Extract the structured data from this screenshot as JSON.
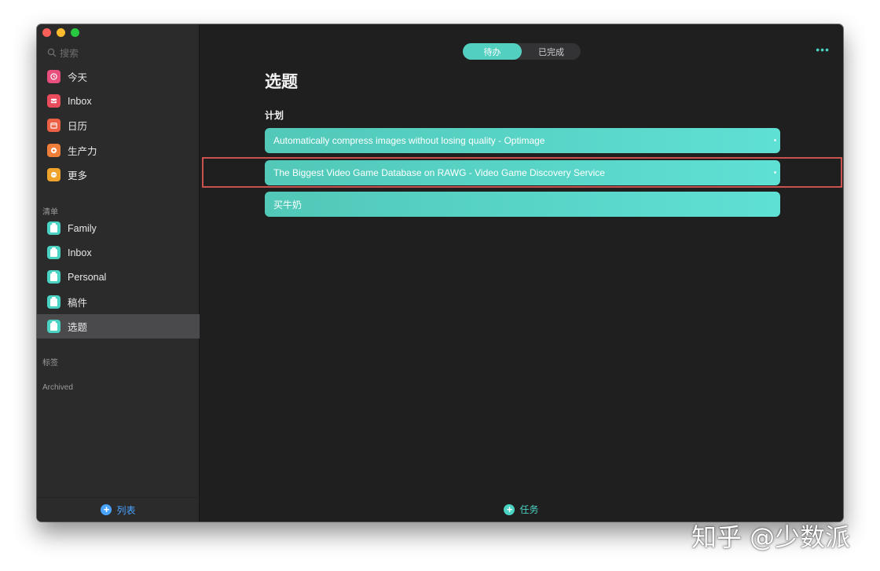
{
  "sidebar": {
    "search_placeholder": "搜索",
    "smart_lists": [
      {
        "label": "今天",
        "icon": "today-icon",
        "color": "#e94f7c"
      },
      {
        "label": "Inbox",
        "icon": "inbox-icon",
        "color": "#e84c5d"
      },
      {
        "label": "日历",
        "icon": "calendar-icon",
        "color": "#ec6045"
      },
      {
        "label": "生产力",
        "icon": "productivity-icon",
        "color": "#ef7e3a"
      },
      {
        "label": "更多",
        "icon": "more-icon",
        "color": "#f0a32b"
      }
    ],
    "lists_section_label": "清单",
    "lists": [
      {
        "label": "Family"
      },
      {
        "label": "Inbox"
      },
      {
        "label": "Personal"
      },
      {
        "label": "稿件"
      },
      {
        "label": "选题",
        "active": true
      }
    ],
    "tags_section_label": "标签",
    "archived_section_label": "Archived",
    "footer_label": "列表",
    "list_icon_color": "#4ad3c2",
    "footer_color": "#4aa3ff"
  },
  "main": {
    "tabs": [
      {
        "label": "待办",
        "active": true
      },
      {
        "label": "已完成",
        "active": false
      }
    ],
    "more_label": "•••",
    "title": "选题",
    "group_title": "计划",
    "tasks": [
      {
        "text": "Automatically compress images without losing quality - Optimage"
      },
      {
        "text": "The Biggest Video Game Database on RAWG - Video Game Discovery Service"
      },
      {
        "text": "买牛奶"
      }
    ],
    "footer_label": "任务",
    "accent_color": "#53cfc0"
  },
  "watermark": "知乎 @少数派"
}
